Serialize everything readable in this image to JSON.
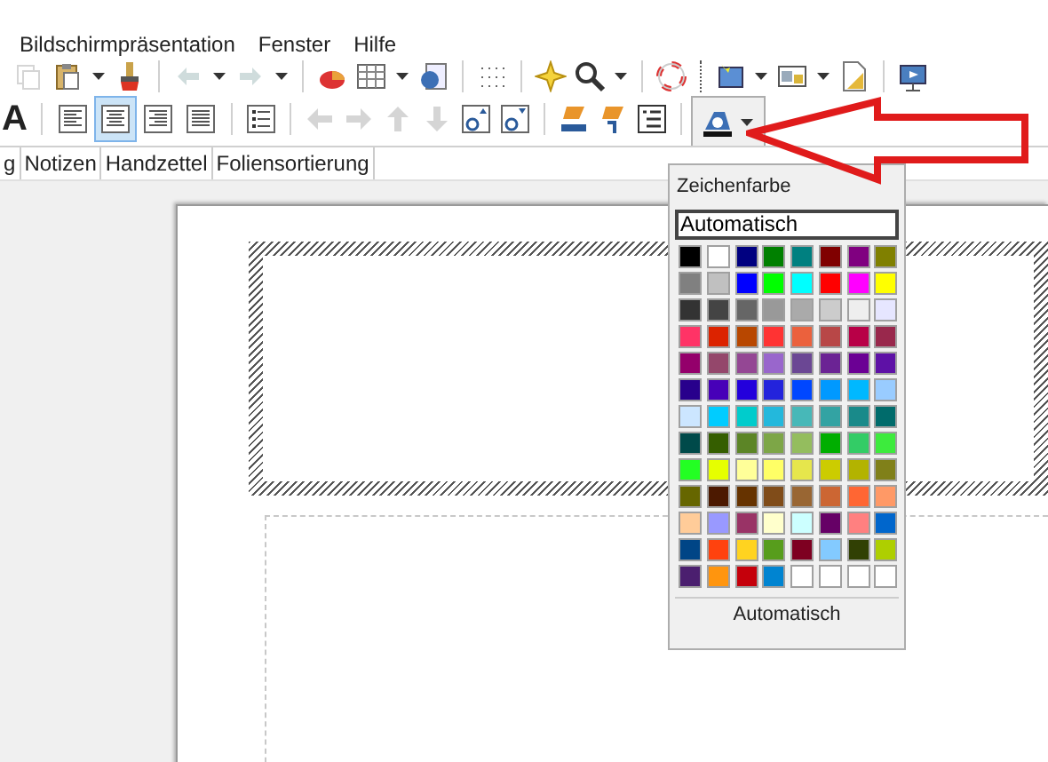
{
  "menu": [
    {
      "label": "Bildschirmpräsentation"
    },
    {
      "label": "Fenster"
    },
    {
      "label": "Hilfe"
    }
  ],
  "toolbar": {
    "font_style": "A",
    "align_buttons": [
      {
        "selected": false
      },
      {
        "selected": true
      },
      {
        "selected": false
      },
      {
        "selected": false
      }
    ],
    "font_color_button": {
      "pressed": true
    }
  },
  "view_tabs": [
    {
      "label": "g"
    },
    {
      "label": "Notizen"
    },
    {
      "label": "Handzettel"
    },
    {
      "label": "Foliensortierung"
    }
  ],
  "color_popup": {
    "title": "Zeichenfarbe",
    "palette_field": {
      "value": "Automatisch"
    },
    "colors": [
      {
        "color": "#000000"
      },
      {
        "color": "#ffffff"
      },
      {
        "color": "#000080"
      },
      {
        "color": "#008000"
      },
      {
        "color": "#008080"
      },
      {
        "color": "#800000"
      },
      {
        "color": "#800080"
      },
      {
        "color": "#808000"
      },
      {
        "color": "#808080"
      },
      {
        "color": "#c0c0c0"
      },
      {
        "color": "#0000ff"
      },
      {
        "color": "#00ff00"
      },
      {
        "color": "#00ffff"
      },
      {
        "color": "#ff0000"
      },
      {
        "color": "#ff00ff"
      },
      {
        "color": "#ffff00"
      },
      {
        "color": "#333333"
      },
      {
        "color": "#444444"
      },
      {
        "color": "#666666"
      },
      {
        "color": "#999999"
      },
      {
        "color": "#aaaaaa"
      },
      {
        "color": "#cccccc"
      },
      {
        "color": "#eeeeee"
      },
      {
        "color": "#e6e6ff"
      },
      {
        "color": "#ff3366"
      },
      {
        "color": "#dc2300"
      },
      {
        "color": "#b84700"
      },
      {
        "color": "#ff3333"
      },
      {
        "color": "#eb613d"
      },
      {
        "color": "#b84747"
      },
      {
        "color": "#b80047"
      },
      {
        "color": "#99284c"
      },
      {
        "color": "#94006b"
      },
      {
        "color": "#94476b"
      },
      {
        "color": "#944794"
      },
      {
        "color": "#9966cc"
      },
      {
        "color": "#6b4794"
      },
      {
        "color": "#6b2394"
      },
      {
        "color": "#6b0094"
      },
      {
        "color": "#5e11a6"
      },
      {
        "color": "#28008c"
      },
      {
        "color": "#4700b8"
      },
      {
        "color": "#2300dc"
      },
      {
        "color": "#2323dc"
      },
      {
        "color": "#0047ff"
      },
      {
        "color": "#0099ff"
      },
      {
        "color": "#00b8ff"
      },
      {
        "color": "#99ccff"
      },
      {
        "color": "#cce6ff"
      },
      {
        "color": "#00ccff"
      },
      {
        "color": "#00cccc"
      },
      {
        "color": "#23b8dc"
      },
      {
        "color": "#47b8b8"
      },
      {
        "color": "#33a3a3"
      },
      {
        "color": "#198a8a"
      },
      {
        "color": "#006b6b"
      },
      {
        "color": "#004a4a"
      },
      {
        "color": "#355e00"
      },
      {
        "color": "#5c8526"
      },
      {
        "color": "#7da647"
      },
      {
        "color": "#94bd5e"
      },
      {
        "color": "#00ae00"
      },
      {
        "color": "#33cc66"
      },
      {
        "color": "#3deb3d"
      },
      {
        "color": "#23ff23"
      },
      {
        "color": "#e6ff00"
      },
      {
        "color": "#ffff99"
      },
      {
        "color": "#ffff66"
      },
      {
        "color": "#e6e64c"
      },
      {
        "color": "#cccc00"
      },
      {
        "color": "#b3b300"
      },
      {
        "color": "#808019"
      },
      {
        "color": "#666600"
      },
      {
        "color": "#4c1900"
      },
      {
        "color": "#663300"
      },
      {
        "color": "#804c19"
      },
      {
        "color": "#996633"
      },
      {
        "color": "#cc6633"
      },
      {
        "color": "#ff6633"
      },
      {
        "color": "#ff9966"
      },
      {
        "color": "#ffcc99"
      },
      {
        "color": "#9999ff"
      },
      {
        "color": "#993366"
      },
      {
        "color": "#ffffcc"
      },
      {
        "color": "#ccffff"
      },
      {
        "color": "#660066"
      },
      {
        "color": "#ff8080"
      },
      {
        "color": "#0066cc"
      },
      {
        "color": "#004586"
      },
      {
        "color": "#ff420e"
      },
      {
        "color": "#ffd320"
      },
      {
        "color": "#579d1c"
      },
      {
        "color": "#7e0021"
      },
      {
        "color": "#83caff"
      },
      {
        "color": "#314004"
      },
      {
        "color": "#aecf00"
      },
      {
        "color": "#4b1f6f"
      },
      {
        "color": "#ff950e"
      },
      {
        "color": "#c5000b"
      },
      {
        "color": "#0084d1"
      },
      {
        "color": "#ffffff"
      },
      {
        "color": "#ffffff"
      },
      {
        "color": "#ffffff"
      },
      {
        "color": "#ffffff"
      }
    ],
    "automatic_button": "Automatisch"
  }
}
